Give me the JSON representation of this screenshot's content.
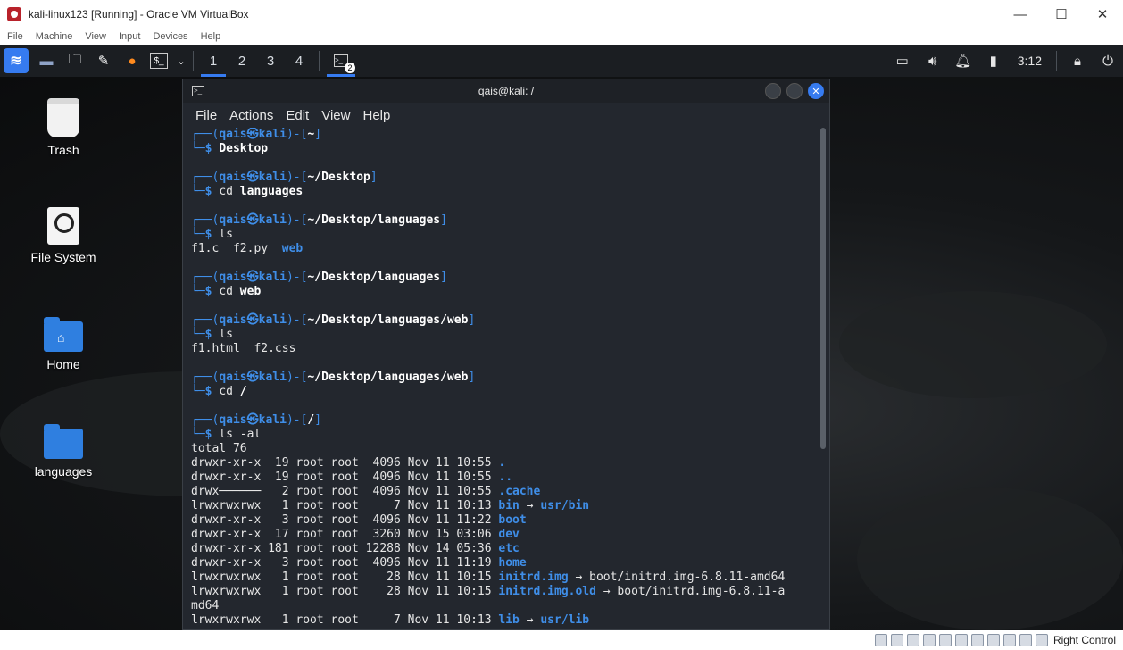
{
  "host": {
    "title": "kali-linux123 [Running] - Oracle VM VirtualBox",
    "menu": [
      "File",
      "Machine",
      "View",
      "Input",
      "Devices",
      "Help"
    ],
    "controls": {
      "minimize": "—",
      "maximize": "☐",
      "close": "✕"
    },
    "status": {
      "host_key": "Right Control"
    }
  },
  "panel": {
    "workspaces": [
      "1",
      "2",
      "3",
      "4"
    ],
    "active_workspace": "1",
    "task_badge": "2",
    "clock": "3:12"
  },
  "desktop": {
    "icons": [
      {
        "label": "Trash"
      },
      {
        "label": "File System"
      },
      {
        "label": "Home"
      },
      {
        "label": "languages"
      }
    ]
  },
  "terminal": {
    "title": "qais@kali: /",
    "menu": [
      "File",
      "Actions",
      "Edit",
      "View",
      "Help"
    ],
    "prompt": {
      "top": "┌──(",
      "user": "qais㉿kali",
      "mid": ")-[",
      "end": "]",
      "bottom": "└─",
      "dollar": "$ "
    },
    "sessions": [
      {
        "path": "~",
        "cmd": "Desktop",
        "cmd_style": "cmd",
        "output": []
      },
      {
        "path": "~/Desktop",
        "cmd_prefix": "cd ",
        "cmd": "languages",
        "output": []
      },
      {
        "path": "~/Desktop/languages",
        "cmd_prefix": "ls",
        "cmd": "",
        "output": [
          {
            "plain": "f1.c  f2.py  ",
            "dir": "web",
            "rest": ""
          }
        ]
      },
      {
        "path": "~/Desktop/languages",
        "cmd_prefix": "cd ",
        "cmd": "web",
        "output": []
      },
      {
        "path": "~/Desktop/languages/web",
        "cmd_prefix": "ls",
        "cmd": "",
        "output": [
          {
            "plain": "f1.html  f2.css",
            "dir": "",
            "rest": ""
          }
        ]
      },
      {
        "path": "~/Desktop/languages/web",
        "cmd_prefix": "cd ",
        "cmd": "/",
        "output": []
      },
      {
        "path": "/",
        "cmd_prefix": "ls -al",
        "cmd": "",
        "output": [
          {
            "plain": "total 76",
            "dir": "",
            "rest": ""
          },
          {
            "plain": "drwxr-xr-x  19 root root  4096 Nov 11 10:55 ",
            "dir": ".",
            "rest": ""
          },
          {
            "plain": "drwxr-xr-x  19 root root  4096 Nov 11 10:55 ",
            "dir": "..",
            "rest": ""
          },
          {
            "plain": "drwx──────   2 root root  4096 Nov 11 10:55 ",
            "dir": ".cache",
            "rest": ""
          },
          {
            "plain": "lrwxrwxrwx   1 root root     7 Nov 11 10:13 ",
            "dir": "bin",
            "rest": " → ",
            "target_dir": "usr/bin"
          },
          {
            "plain": "drwxr-xr-x   3 root root  4096 Nov 11 11:22 ",
            "dir": "boot",
            "rest": ""
          },
          {
            "plain": "drwxr-xr-x  17 root root  3260 Nov 15 03:06 ",
            "dir": "dev",
            "rest": ""
          },
          {
            "plain": "drwxr-xr-x 181 root root 12288 Nov 14 05:36 ",
            "dir": "etc",
            "rest": ""
          },
          {
            "plain": "drwxr-xr-x   3 root root  4096 Nov 11 11:19 ",
            "dir": "home",
            "rest": ""
          },
          {
            "plain": "lrwxrwxrwx   1 root root    28 Nov 11 10:15 ",
            "dir": "initrd.img",
            "rest": " → boot/initrd.img-6.8.11-amd64"
          },
          {
            "plain": "lrwxrwxrwx   1 root root    28 Nov 11 10:15 ",
            "dir": "initrd.img.old",
            "rest": " → boot/initrd.img-6.8.11-a"
          },
          {
            "plain": "md64",
            "dir": "",
            "rest": ""
          },
          {
            "plain": "lrwxrwxrwx   1 root root     7 Nov 11 10:13 ",
            "dir": "lib",
            "rest": " → ",
            "target_dir": "usr/lib"
          }
        ]
      }
    ]
  }
}
